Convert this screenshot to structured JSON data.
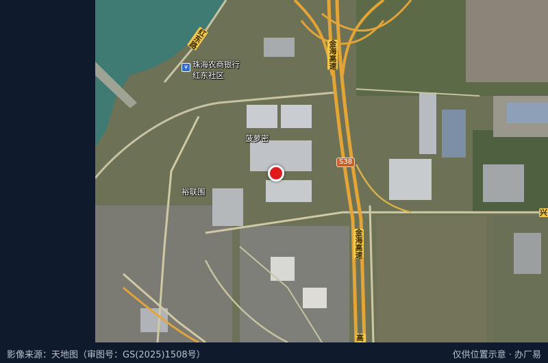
{
  "map": {
    "place_labels": [
      {
        "id": "zhuhai-bank",
        "text": "珠海农商银行"
      },
      {
        "id": "hongdong",
        "text": "红东社区"
      },
      {
        "id": "boluomi",
        "text": "菠萝密"
      },
      {
        "id": "yulianwei",
        "text": "裕联围"
      }
    ],
    "road_labels": {
      "jinhai_upper": "金海高速",
      "jinhai_lower": "金海高速",
      "hongdong_road": "红东路",
      "bottom_partial": "高",
      "right_edge": "兴"
    },
    "route_shield": "S38",
    "bank_icon_glyph": "¥",
    "colors": {
      "marker": "#e11b1b",
      "highway": "#e3a537",
      "water": "#3f7b72",
      "sidebar": "#0f1a2d"
    }
  },
  "footer": {
    "source": "影像来源：天地图（审图号：GS(2025)1508号）",
    "disclaimer": "仅供位置示意 · 办厂易"
  }
}
